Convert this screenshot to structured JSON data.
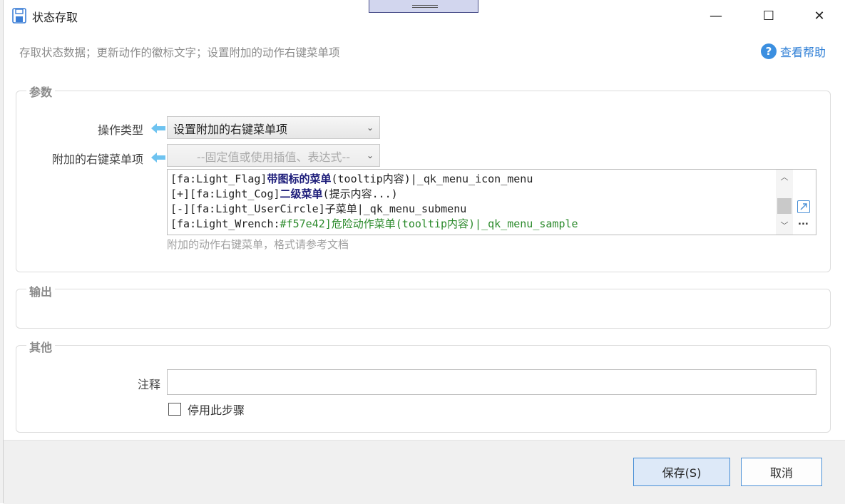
{
  "window": {
    "title": "状态存取",
    "minimize_glyph": "—",
    "maximize_glyph": "☐",
    "close_glyph": "✕"
  },
  "header": {
    "subtitle": "存取状态数据；更新动作的徽标文字；设置附加的动作右键菜单项",
    "help_label": "查看帮助",
    "help_glyph": "?"
  },
  "groups": {
    "params": "参数",
    "output": "输出",
    "other": "其他"
  },
  "params": {
    "op_type_label": "操作类型",
    "op_type_value": "设置附加的右键菜单项",
    "menu_label": "附加的右键菜单项",
    "menu_select_placeholder": "--固定值或使用插值、表达式--",
    "chevron": "⌄",
    "hint": "附加的动作右键菜单，格式请参考文档",
    "editor_lines": [
      [
        "[fa:Light_Flag]",
        "带图标的菜单",
        "(tooltip内容)|_qk_menu_icon_menu"
      ],
      [
        "[+][fa:Light_Cog]",
        "二级菜单",
        "(提示内容...)"
      ],
      [
        "[-][fa:Light_UserCircle]子菜单|_qk_menu_submenu"
      ],
      [
        "[fa:Light_Wrench:",
        "#f57e42]危险动作菜单(tooltip内容)|_qk_menu_sample"
      ]
    ],
    "scroll_up": "︿",
    "scroll_down": "﹀",
    "more_glyph": "..."
  },
  "other": {
    "note_label": "注释",
    "note_value": "",
    "disable_label": "停用此步骤",
    "disable_checked": false
  },
  "footer": {
    "save_label": "保存(S)",
    "cancel_label": "取消"
  },
  "colors": {
    "accent": "#4a90d6",
    "help_blue": "#2f7fd6",
    "bold_blue": "#1a1a78",
    "green": "#2b8a2b"
  }
}
